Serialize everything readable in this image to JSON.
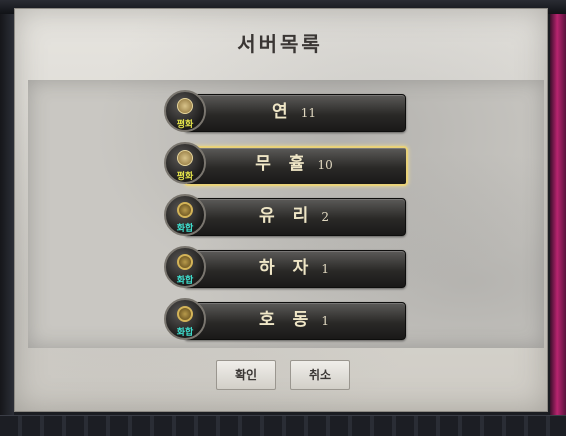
{
  "title": "서버목록",
  "servers": [
    {
      "name": "연",
      "count": "11",
      "tag": "평화",
      "type": "peace",
      "selected": false
    },
    {
      "name": "무 휼",
      "count": "10",
      "tag": "평화",
      "type": "peace",
      "selected": true
    },
    {
      "name": "유 리",
      "count": "2",
      "tag": "화합",
      "type": "harmony",
      "selected": false
    },
    {
      "name": "하 자",
      "count": "1",
      "tag": "화합",
      "type": "harmony",
      "selected": false
    },
    {
      "name": "호 동",
      "count": "1",
      "tag": "화합",
      "type": "harmony",
      "selected": false
    }
  ],
  "buttons": {
    "confirm": "확인",
    "cancel": "취소"
  },
  "colors": {
    "peace_tag": "#e2e24a",
    "harmony_tag": "#3fe0d0",
    "selected_border": "#e9d27a"
  }
}
